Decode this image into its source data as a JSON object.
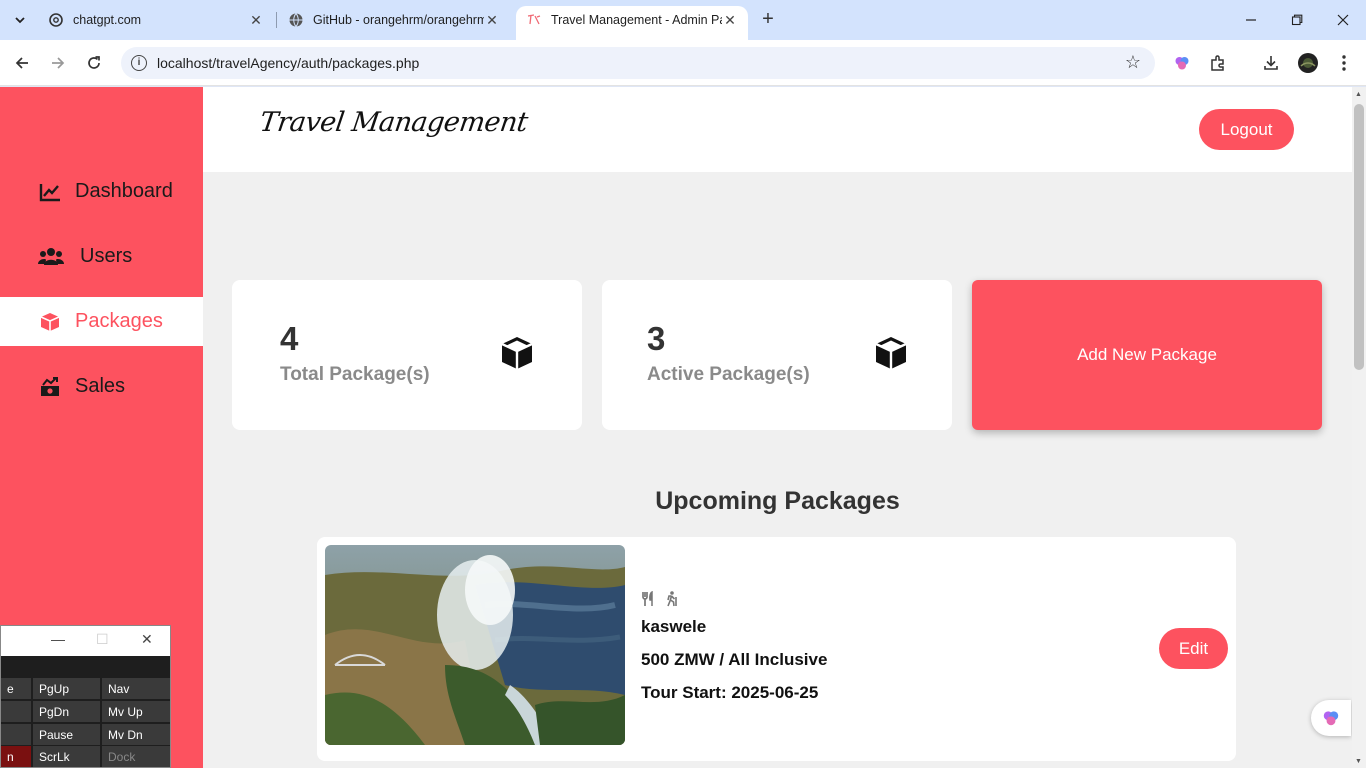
{
  "browser": {
    "tabs": [
      {
        "title": "chatgpt.com",
        "favicon": "openai-logo-icon"
      },
      {
        "title": "GitHub - orangehrm/orangehrm",
        "favicon": "globe-icon"
      },
      {
        "title": "Travel Management - Admin Pa",
        "favicon": "travel-logo-icon"
      }
    ],
    "url": "localhost/travelAgency/auth/packages.php"
  },
  "app": {
    "brand": "Travel Management",
    "logout_label": "Logout",
    "accent_color": "#fd525f"
  },
  "sidebar": {
    "items": [
      {
        "label": "Dashboard",
        "icon": "chart-line-icon",
        "active": false
      },
      {
        "label": "Users",
        "icon": "users-icon",
        "active": false
      },
      {
        "label": "Packages",
        "icon": "box-icon",
        "active": true
      },
      {
        "label": "Sales",
        "icon": "sales-icon",
        "active": false
      }
    ]
  },
  "stats": [
    {
      "value": "4",
      "label": "Total Package(s)",
      "icon": "box-icon"
    },
    {
      "value": "3",
      "label": "Active Package(s)",
      "icon": "box-icon"
    }
  ],
  "add_package_label": "Add New Package",
  "upcoming": {
    "title": "Upcoming Packages",
    "packages": [
      {
        "amenity_icons": [
          "utensils-icon",
          "hiking-icon"
        ],
        "name": "kaswele",
        "price": "500 ZMW / All Inclusive",
        "start": "Tour Start: 2025-06-25",
        "edit_label": "Edit",
        "image": "waterfall-photo"
      }
    ]
  },
  "keyboard": {
    "keys": [
      [
        "e",
        "PgUp",
        "Nav"
      ],
      [
        "",
        "PgDn",
        "Mv Up"
      ],
      [
        "",
        "Pause",
        "Mv Dn"
      ],
      [
        "n",
        "ScrLk",
        "Dock"
      ]
    ]
  }
}
